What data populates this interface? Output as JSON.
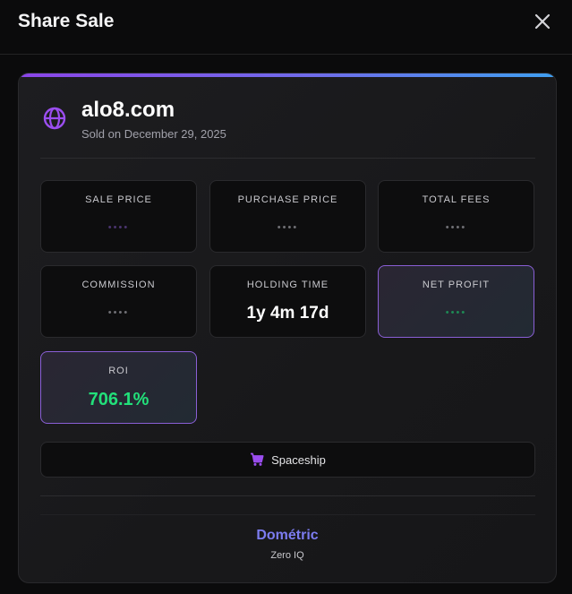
{
  "dialog": {
    "title": "Share Sale"
  },
  "colors": {
    "accent_purple": "#8b45e8",
    "accent_blue": "#3f9ff0",
    "roi_green": "#22e07a",
    "brand": "#7c7cf0"
  },
  "domain": {
    "name": "alo8.com",
    "sold_on": "Sold on December 29, 2025",
    "icon": "globe-icon"
  },
  "stats": {
    "sale_price": {
      "label": "SALE PRICE",
      "value": "••••"
    },
    "purchase_price": {
      "label": "PURCHASE PRICE",
      "value": "••••"
    },
    "total_fees": {
      "label": "TOTAL FEES",
      "value": "••••"
    },
    "commission": {
      "label": "COMMISSION",
      "value": "••••"
    },
    "holding_time": {
      "label": "HOLDING TIME",
      "value": "1y 4m 17d"
    },
    "net_profit": {
      "label": "NET PROFIT",
      "value": "••••"
    },
    "roi": {
      "label": "ROI",
      "value": "706.1%"
    }
  },
  "registrar": {
    "label": "Spaceship",
    "icon": "cart-icon"
  },
  "footer": {
    "brand": "Dométric",
    "subtitle": "Zero IQ"
  }
}
